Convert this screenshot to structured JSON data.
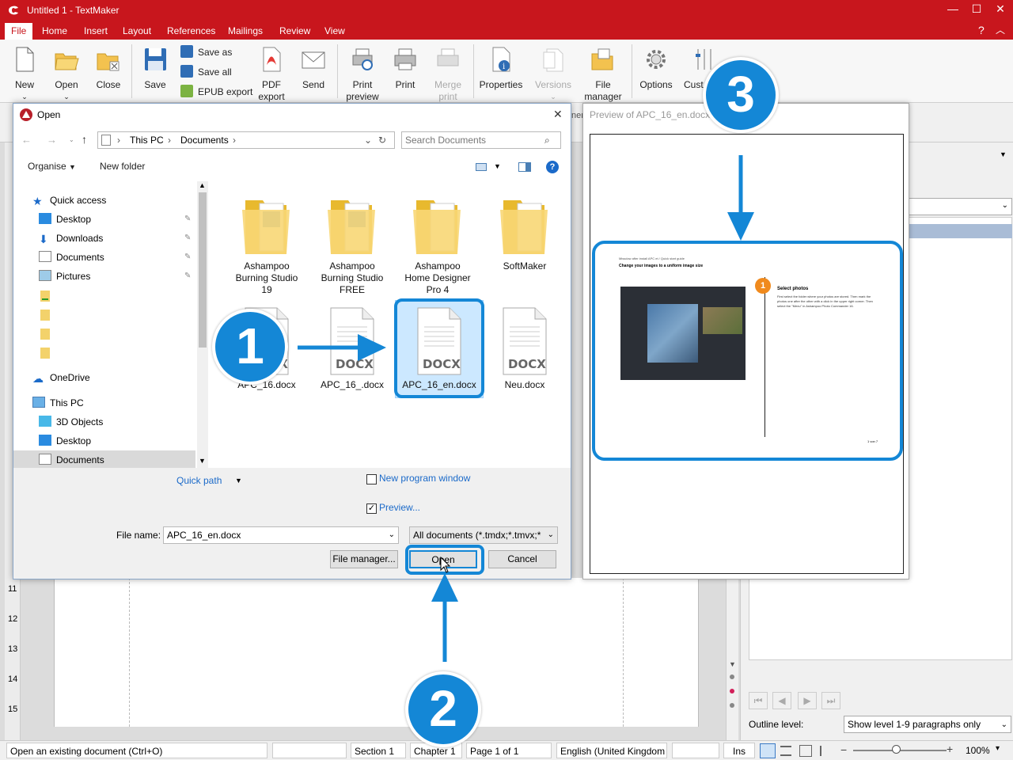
{
  "app": {
    "title": "Untitled 1 - TextMaker",
    "help": "?",
    "min": "—",
    "max": "☐",
    "close": "✕"
  },
  "menu": [
    "File",
    "Home",
    "Insert",
    "Layout",
    "References",
    "Mailings",
    "Review",
    "View"
  ],
  "ribbon": {
    "new": "New",
    "open": "Open",
    "close": "Close",
    "save": "Save",
    "save_as": "Save as",
    "save_all": "Save all",
    "epub": "EPUB export",
    "pdf_line1": "PDF",
    "pdf_line2": "export",
    "send": "Send",
    "print_preview_1": "Print",
    "print_preview_2": "preview",
    "print": "Print",
    "merge_1": "Merge",
    "merge_2": "print",
    "properties": "Properties",
    "versions": "Versions",
    "file_manager_1": "File",
    "file_manager_2": "manager",
    "options": "Options",
    "customize": "Cust",
    "hidden_tab": "ner"
  },
  "dialog": {
    "title": "Open",
    "close": "✕",
    "breadcrumb": [
      "This PC",
      "Documents"
    ],
    "search_placeholder": "Search Documents",
    "organise": "Organise",
    "new_folder": "New folder",
    "nav": {
      "quick_access": "Quick access",
      "desktop": "Desktop",
      "downloads": "Downloads",
      "documents": "Documents",
      "pictures": "Pictures",
      "onedrive": "OneDrive",
      "this_pc": "This PC",
      "objects3d": "3D Objects",
      "desktop2": "Desktop",
      "documents2": "Documents"
    },
    "folders": [
      {
        "l1": "Ashampoo",
        "l2": "Burning Studio",
        "l3": "19"
      },
      {
        "l1": "Ashampoo",
        "l2": "Burning Studio",
        "l3": "FREE"
      },
      {
        "l1": "Ashampoo",
        "l2": "Home Designer",
        "l3": "Pro 4"
      },
      {
        "l1": "SoftMaker",
        "l2": "",
        "l3": ""
      }
    ],
    "files": [
      {
        "name": "APC_16.docx",
        "type": "DOCX"
      },
      {
        "name": "APC_16_.docx",
        "type": "DOCX"
      },
      {
        "name": "APC_16_en.docx",
        "type": "DOCX"
      },
      {
        "name": "Neu.docx",
        "type": "DOCX"
      }
    ],
    "quick_path": "Quick path",
    "new_window": "New program window",
    "preview": "Preview...",
    "file_name_label": "File name:",
    "file_name_value": "APC_16_en.docx",
    "file_type": "All documents (*.tmdx;*.tmvx;*",
    "file_manager_btn": "File manager...",
    "open_btn": "Open",
    "cancel_btn": "Cancel"
  },
  "preview_panel": {
    "title": "Preview of APC_16_en.docx",
    "doc_header": "Missdow after install APC et / Quick start guide",
    "doc_title": "Change your images to a uniform image size",
    "step_number": "1",
    "step_title": "Select photos",
    "step_text": "First select the folder where your photos are stored. Then mark the photos one after the other with a click in the upper right corner. Then select the \"Menu\" in Ashampoo Photo Commander 16.",
    "page_footer": "1 von 7"
  },
  "callouts": [
    "1",
    "2",
    "3"
  ],
  "right_pane": {
    "outline_label": "Outline level:",
    "outline_value": "Show level 1-9 paragraphs only"
  },
  "ruler_numbers": [
    "11",
    "12",
    "13",
    "14",
    "15"
  ],
  "status": {
    "hint": "Open an existing document (Ctrl+O)",
    "section": "Section 1",
    "chapter": "Chapter 1",
    "page": "Page 1 of 1",
    "language": "English (United Kingdom",
    "ins": "Ins",
    "zoom": "100%"
  },
  "colors": {
    "brand": "#c8161d",
    "callout": "#1487d6",
    "selection": "#cce8ff"
  }
}
